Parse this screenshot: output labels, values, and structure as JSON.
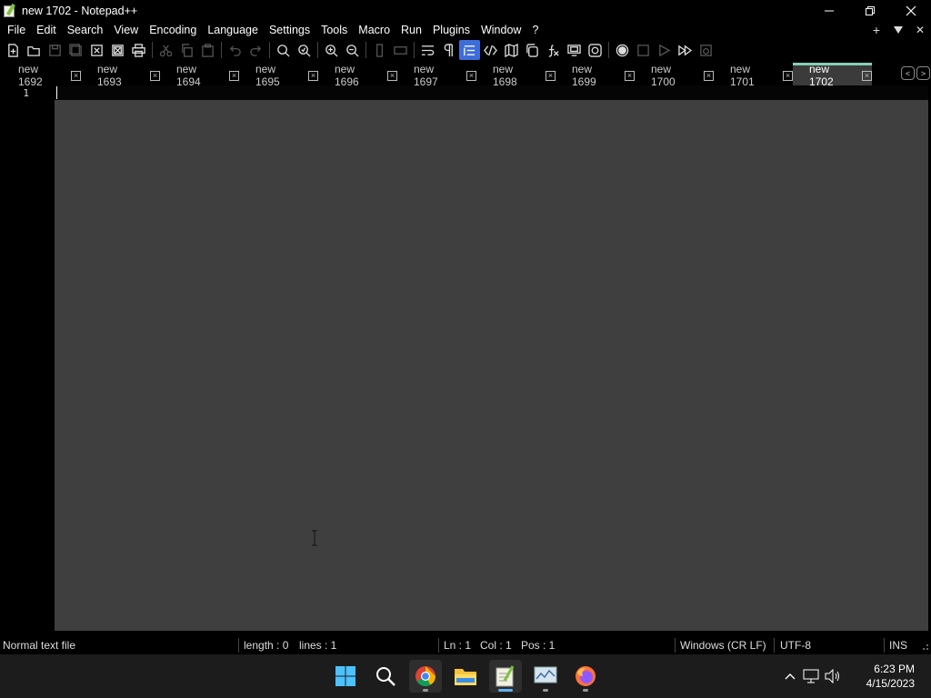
{
  "window": {
    "title": "new 1702 - Notepad++"
  },
  "menu": {
    "items": [
      "File",
      "Edit",
      "Search",
      "View",
      "Encoding",
      "Language",
      "Settings",
      "Tools",
      "Macro",
      "Run",
      "Plugins",
      "Window",
      "?"
    ],
    "right_plus": "+",
    "right_close": "✕"
  },
  "tabs": [
    {
      "label": "new 1692",
      "active": false
    },
    {
      "label": "new 1693",
      "active": false
    },
    {
      "label": "new 1694",
      "active": false
    },
    {
      "label": "new 1695",
      "active": false
    },
    {
      "label": "new 1696",
      "active": false
    },
    {
      "label": "new 1697",
      "active": false
    },
    {
      "label": "new 1698",
      "active": false
    },
    {
      "label": "new 1699",
      "active": false
    },
    {
      "label": "new 1700",
      "active": false
    },
    {
      "label": "new 1701",
      "active": false
    },
    {
      "label": "new 1702",
      "active": true
    }
  ],
  "editor": {
    "line_numbers": [
      "1"
    ]
  },
  "status": {
    "file_type": "Normal text file",
    "length": "length : 0",
    "lines": "lines : 1",
    "ln": "Ln : 1",
    "col": "Col : 1",
    "pos": "Pos : 1",
    "eol": "Windows (CR LF)",
    "encoding": "UTF-8",
    "mode": "INS"
  },
  "taskbar": {
    "time": "6:23 PM",
    "date": "4/15/2023"
  },
  "colors": {
    "active_tab_accent": "#86d0b4",
    "editor_bg": "#3f3f3f",
    "toolbar_active": "#3d6dd8"
  }
}
